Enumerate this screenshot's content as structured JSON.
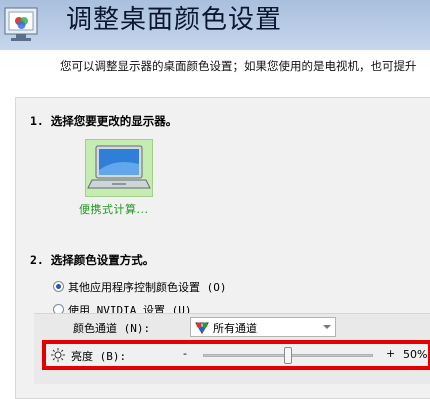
{
  "header": {
    "title": "调整桌面颜色设置",
    "subtitle": "您可以调整显示器的桌面颜色设置；如果您使用的是电视机，也可提升"
  },
  "section1": {
    "title": "1. 选择您要更改的显示器。",
    "monitor_label": "便携式计算..."
  },
  "section2": {
    "title": "2. 选择颜色设置方式。",
    "options": [
      {
        "label": "其他应用程序控制颜色设置 (O)",
        "selected": true
      },
      {
        "label": "使用 NVIDIA 设置 (U)",
        "selected": false
      }
    ],
    "color_channel": {
      "label": "颜色通道 (N):",
      "value": "所有通道"
    },
    "brightness": {
      "label": "亮度 (B):",
      "minus": "-",
      "plus": "+",
      "value_text": "50%",
      "level": 0.5
    }
  },
  "colors": {
    "highlight_border": "#e50000",
    "header_bg": "#b9cce6",
    "monitor_label": "#1f9a1f"
  }
}
